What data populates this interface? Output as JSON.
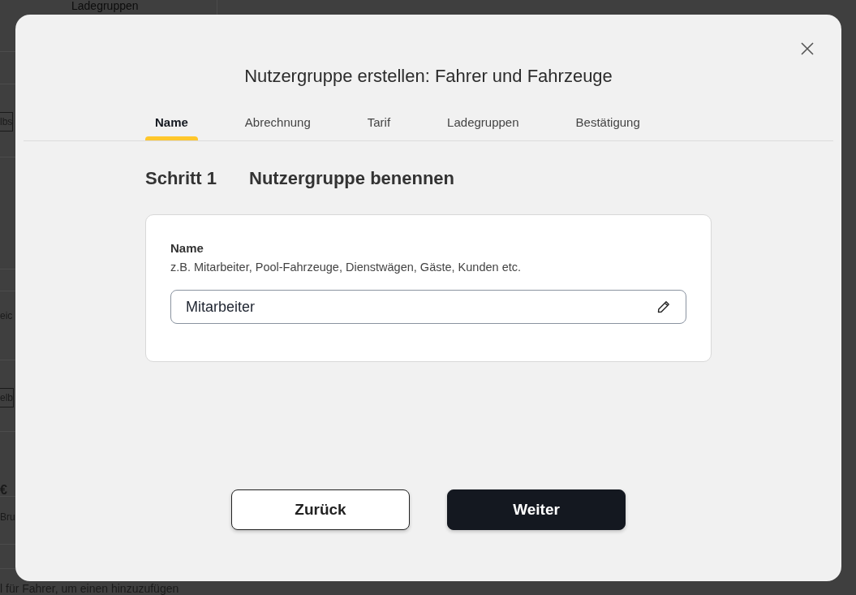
{
  "background": {
    "top_nav_item": "Ladegruppen",
    "fragments": [
      "lbs",
      "eic",
      "elb",
      "€",
      "Bru"
    ],
    "footer_hint": "l für Fahrer, um einen hinzuzufügen"
  },
  "dialog": {
    "title": "Nutzergruppe erstellen: Fahrer und Fahrzeuge",
    "tabs": [
      {
        "label": "Name",
        "selected": true
      },
      {
        "label": "Abrechnung",
        "selected": false
      },
      {
        "label": "Tarif",
        "selected": false
      },
      {
        "label": "Ladegruppen",
        "selected": false
      },
      {
        "label": "Bestätigung",
        "selected": false
      }
    ],
    "step": {
      "number": "Schritt 1",
      "title": "Nutzergruppe benennen"
    },
    "field": {
      "label": "Name",
      "hint": "z.B. Mitarbeiter, Pool-Fahrzeuge, Dienstwägen, Gäste, Kunden etc.",
      "value": "Mitarbeiter"
    },
    "buttons": [
      {
        "label": "Zurück",
        "kind": "secondary"
      },
      {
        "label": "Weiter",
        "kind": "primary"
      }
    ]
  }
}
